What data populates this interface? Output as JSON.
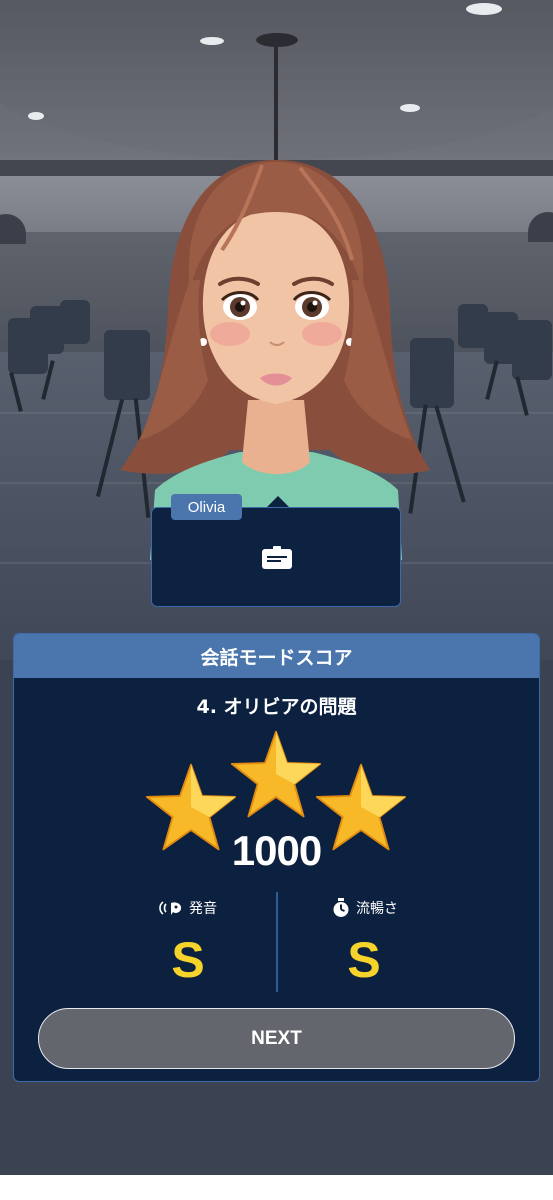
{
  "speaker": {
    "name": "Olivia",
    "chat_icon": "chat-bubble-icon"
  },
  "score_panel": {
    "header": "会話モードスコア",
    "title": "4. オリビアの問題",
    "stars_earned": 3,
    "stars_total": 3,
    "score": "1000",
    "pronunciation": {
      "icon": "pronunciation-icon",
      "label": "発音",
      "grade": "S"
    },
    "fluency": {
      "icon": "stopwatch-icon",
      "label": "流暢さ",
      "grade": "S"
    },
    "next_label": "NEXT"
  },
  "colors": {
    "header_blue": "#4a76ad",
    "panel_navy": "#0c213f",
    "grade_yellow": "#f5d32a",
    "star_gold": "#f7b928"
  }
}
